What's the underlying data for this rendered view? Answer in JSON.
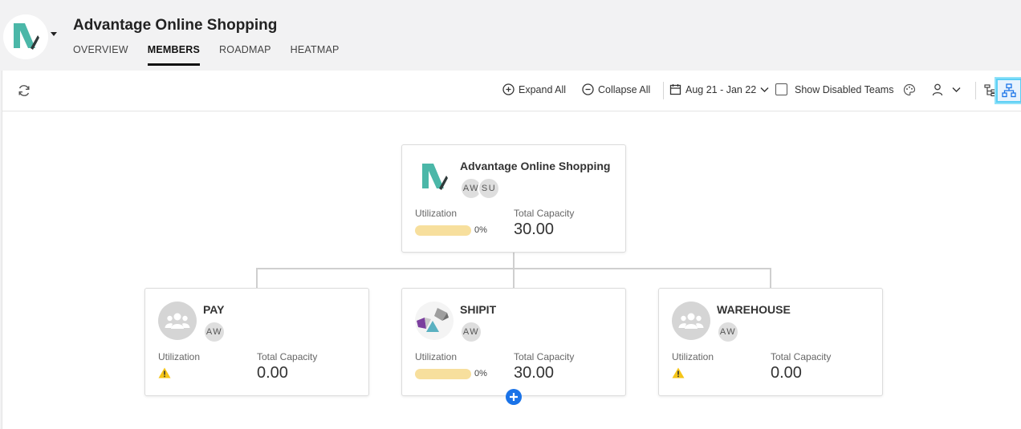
{
  "app": {
    "title": "Advantage Online Shopping",
    "tabs": [
      {
        "label": "OVERVIEW",
        "active": false
      },
      {
        "label": "MEMBERS",
        "active": true
      },
      {
        "label": "ROADMAP",
        "active": false
      },
      {
        "label": "HEATMAP",
        "active": false
      }
    ]
  },
  "toolbar": {
    "expand_all": "Expand All",
    "collapse_all": "Collapse All",
    "date_range": "Aug 21 - Jan 22",
    "show_disabled_teams": "Show Disabled Teams",
    "show_disabled_checked": false,
    "selected_view": "org-chart"
  },
  "colors": {
    "brand_teal": "#4bb7a8",
    "accent_blue": "#1a73e8",
    "utilization_bar": "#f7df9d",
    "warning": "#f5c518"
  },
  "tree": {
    "root": {
      "name": "Advantage Online Shopping",
      "avatars": [
        "AW",
        "SU"
      ],
      "utilization_label": "Utilization",
      "utilization": "0%",
      "capacity_label": "Total Capacity",
      "capacity": "30.00"
    },
    "children": [
      {
        "name": "PAY",
        "avatars": [
          "AW"
        ],
        "utilization_label": "Utilization",
        "capacity_label": "Total Capacity",
        "capacity": "0.00",
        "warning": true
      },
      {
        "name": "SHIPIT",
        "avatars": [
          "AW"
        ],
        "utilization_label": "Utilization",
        "utilization": "0%",
        "capacity_label": "Total Capacity",
        "capacity": "30.00",
        "warning": false
      },
      {
        "name": "WAREHOUSE",
        "avatars": [
          "AW"
        ],
        "utilization_label": "Utilization",
        "capacity_label": "Total Capacity",
        "capacity": "0.00",
        "warning": true
      }
    ]
  }
}
